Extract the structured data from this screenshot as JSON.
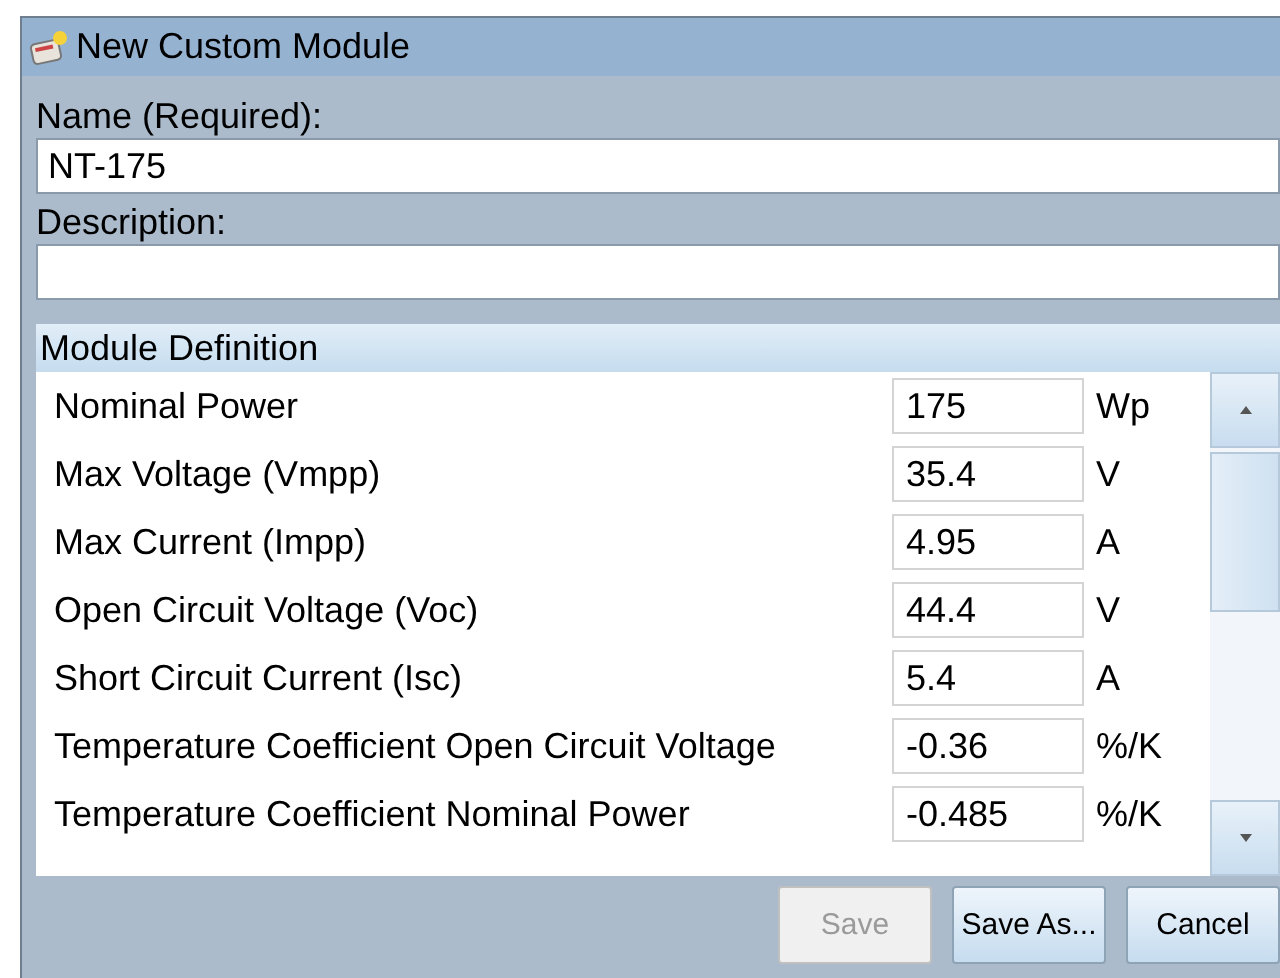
{
  "window": {
    "title": "New Custom Module"
  },
  "name_field": {
    "label": "Name (Required):",
    "value": "NT-175"
  },
  "description_field": {
    "label": "Description:"
  },
  "module_definition": {
    "title": "Module Definition",
    "rows": [
      {
        "label": "Nominal Power",
        "value": "175",
        "unit": "Wp"
      },
      {
        "label": "Max Voltage (Vmpp)",
        "value": "35.4",
        "unit": "V"
      },
      {
        "label": "Max Current (Impp)",
        "value": "4.95",
        "unit": "A"
      },
      {
        "label": "Open Circuit Voltage (Voc)",
        "value": "44.4",
        "unit": "V"
      },
      {
        "label": "Short Circuit Current (Isc)",
        "value": "5.4",
        "unit": "A"
      },
      {
        "label": "Temperature Coefficient Open Circuit Voltage",
        "value": "-0.36",
        "unit": "%/K"
      },
      {
        "label": "Temperature Coefficient Nominal Power",
        "value": "-0.485",
        "unit": "%/K"
      }
    ]
  },
  "buttons": [
    {
      "label": "Save",
      "disabled": true
    },
    {
      "label": "Save As...",
      "disabled": false
    },
    {
      "label": "Cancel",
      "disabled": false
    }
  ]
}
